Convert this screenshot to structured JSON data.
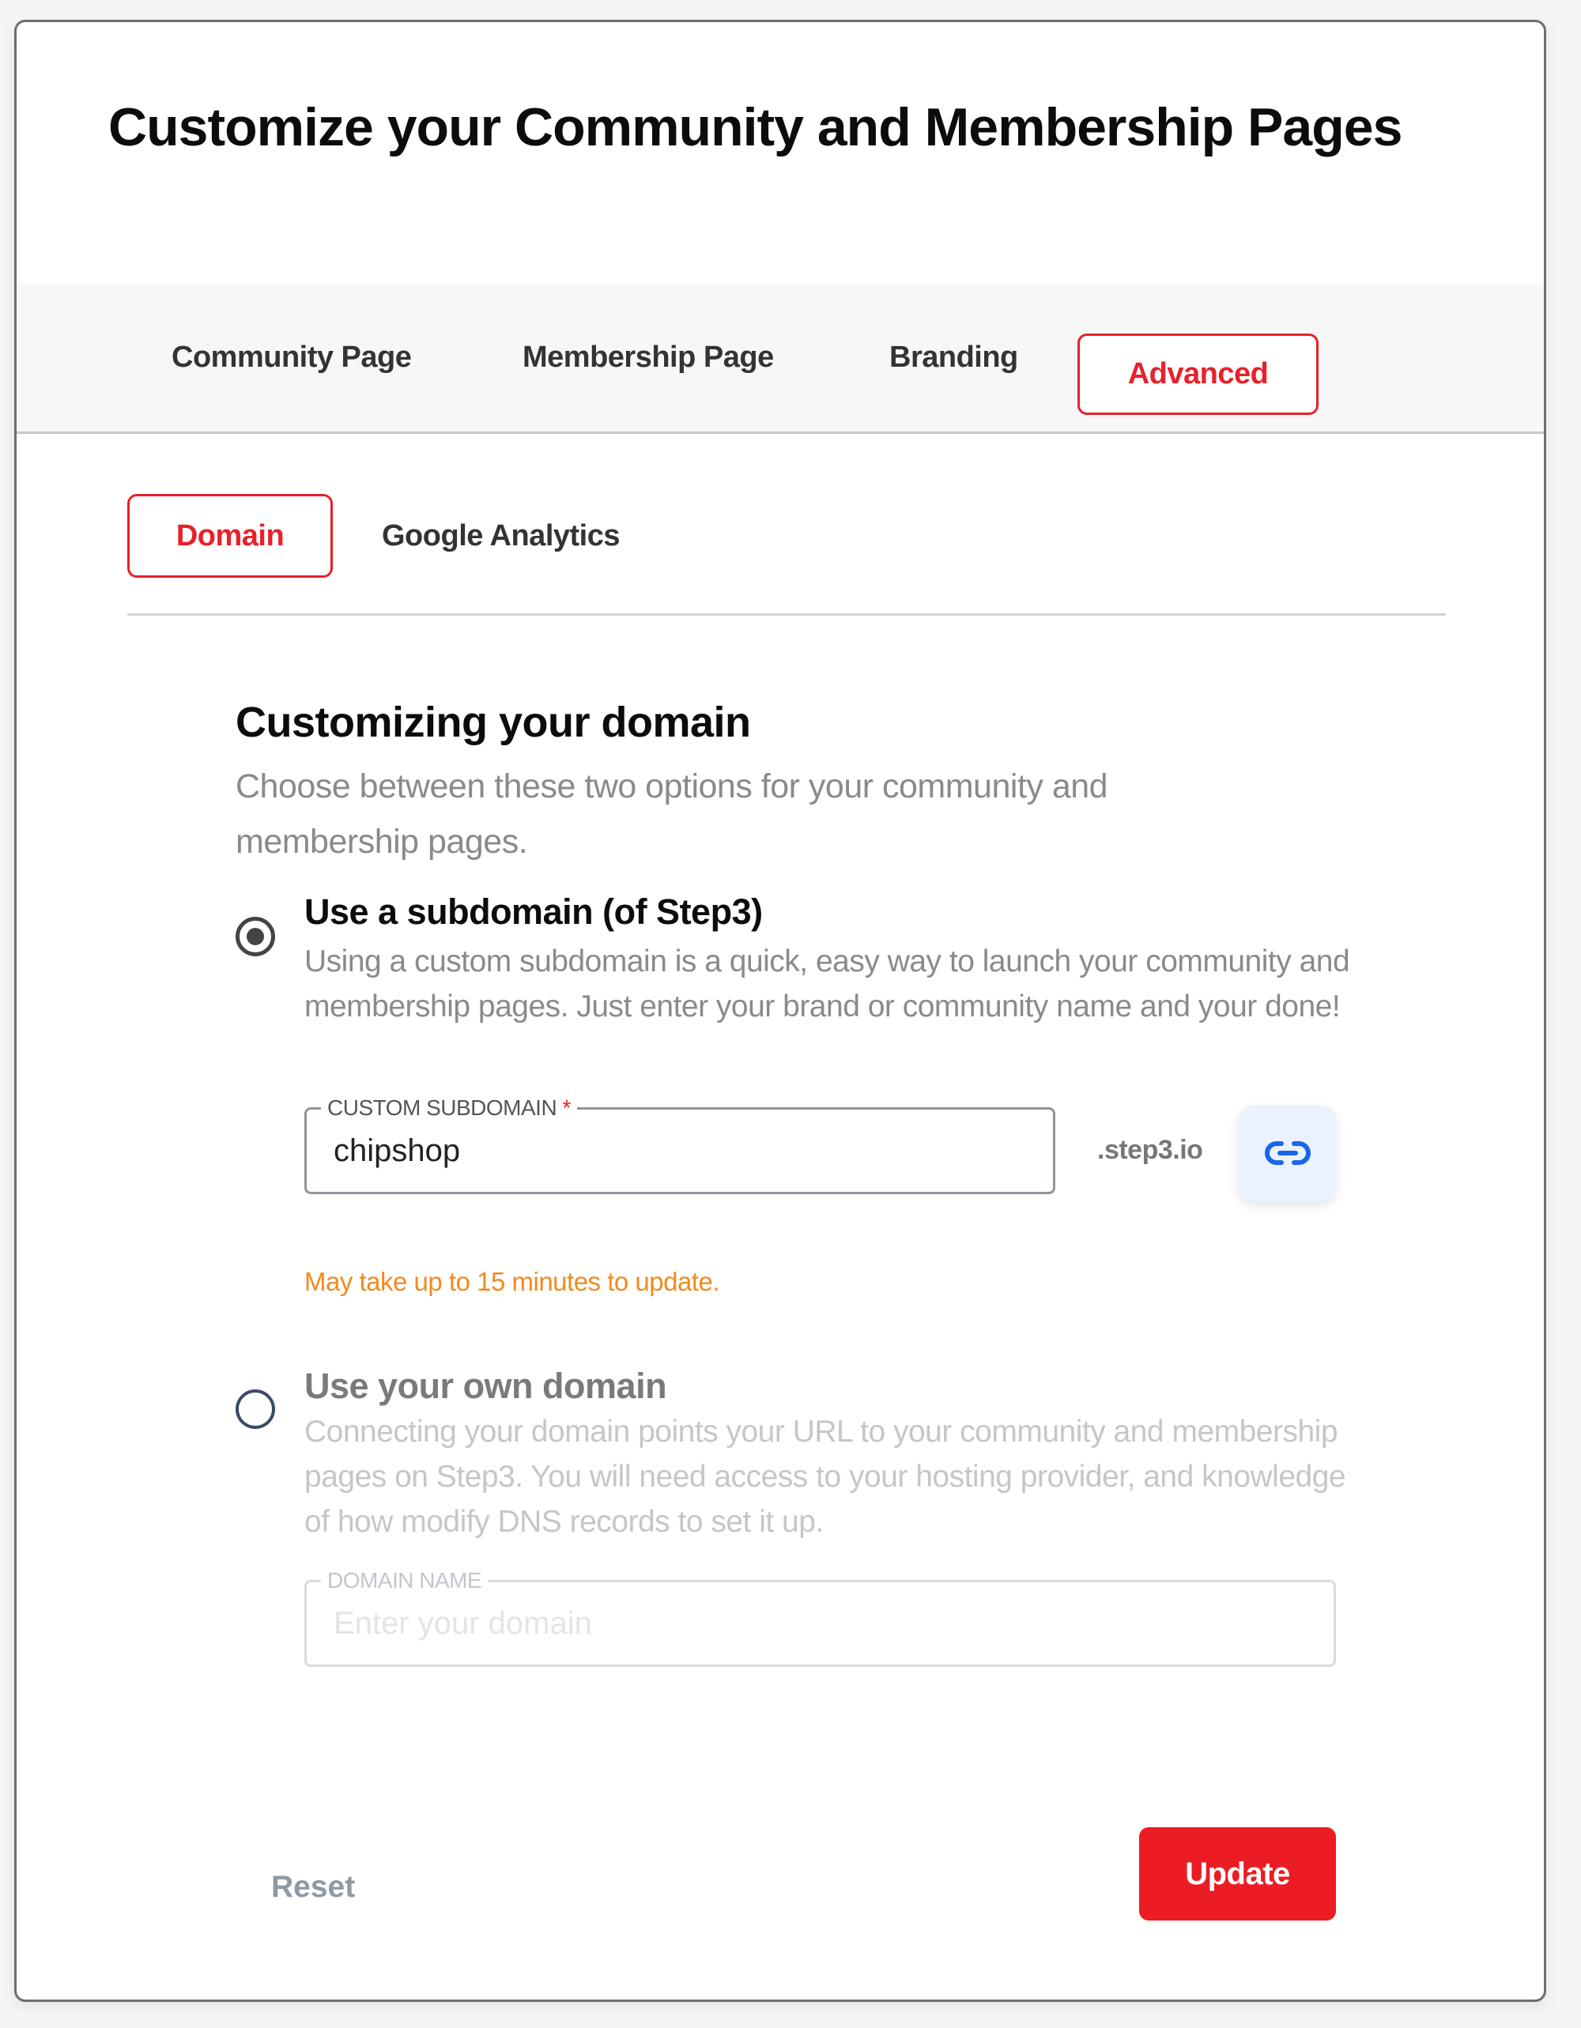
{
  "page": {
    "title": "Customize your Community and Membership Pages"
  },
  "tabs": [
    {
      "label": "Community Page",
      "active": false
    },
    {
      "label": "Membership Page",
      "active": false
    },
    {
      "label": "Branding",
      "active": false
    },
    {
      "label": "Advanced",
      "active": true
    }
  ],
  "subtabs": [
    {
      "label": "Domain",
      "active": true
    },
    {
      "label": "Google Analytics",
      "active": false
    }
  ],
  "section": {
    "title": "Customizing your domain",
    "description": "Choose between these two options for your community and membership pages."
  },
  "options": {
    "subdomain": {
      "selected": true,
      "title": "Use a subdomain (of Step3)",
      "description": "Using a custom subdomain is a quick, easy way to launch your community and membership pages. Just enter your brand or community name and your done!",
      "field_label": "CUSTOM SUBDOMAIN",
      "required_mark": "*",
      "value": "chipshop",
      "suffix": ".step3.io",
      "link_icon": "link-icon",
      "notice": "May take up to 15 minutes to update."
    },
    "own_domain": {
      "selected": false,
      "title": "Use your own domain",
      "description": "Connecting your domain points your URL to your community and membership pages on Step3. You will need access to your hosting provider, and knowledge of how modify DNS records to set it up.",
      "field_label": "DOMAIN NAME",
      "value": "",
      "placeholder": "Enter your domain"
    }
  },
  "actions": {
    "reset_label": "Reset",
    "update_label": "Update"
  },
  "colors": {
    "accent": "#ec1c24",
    "warning": "#f28a1e",
    "link_button_bg": "#e9f2fe",
    "link_icon": "#1a66e8"
  }
}
